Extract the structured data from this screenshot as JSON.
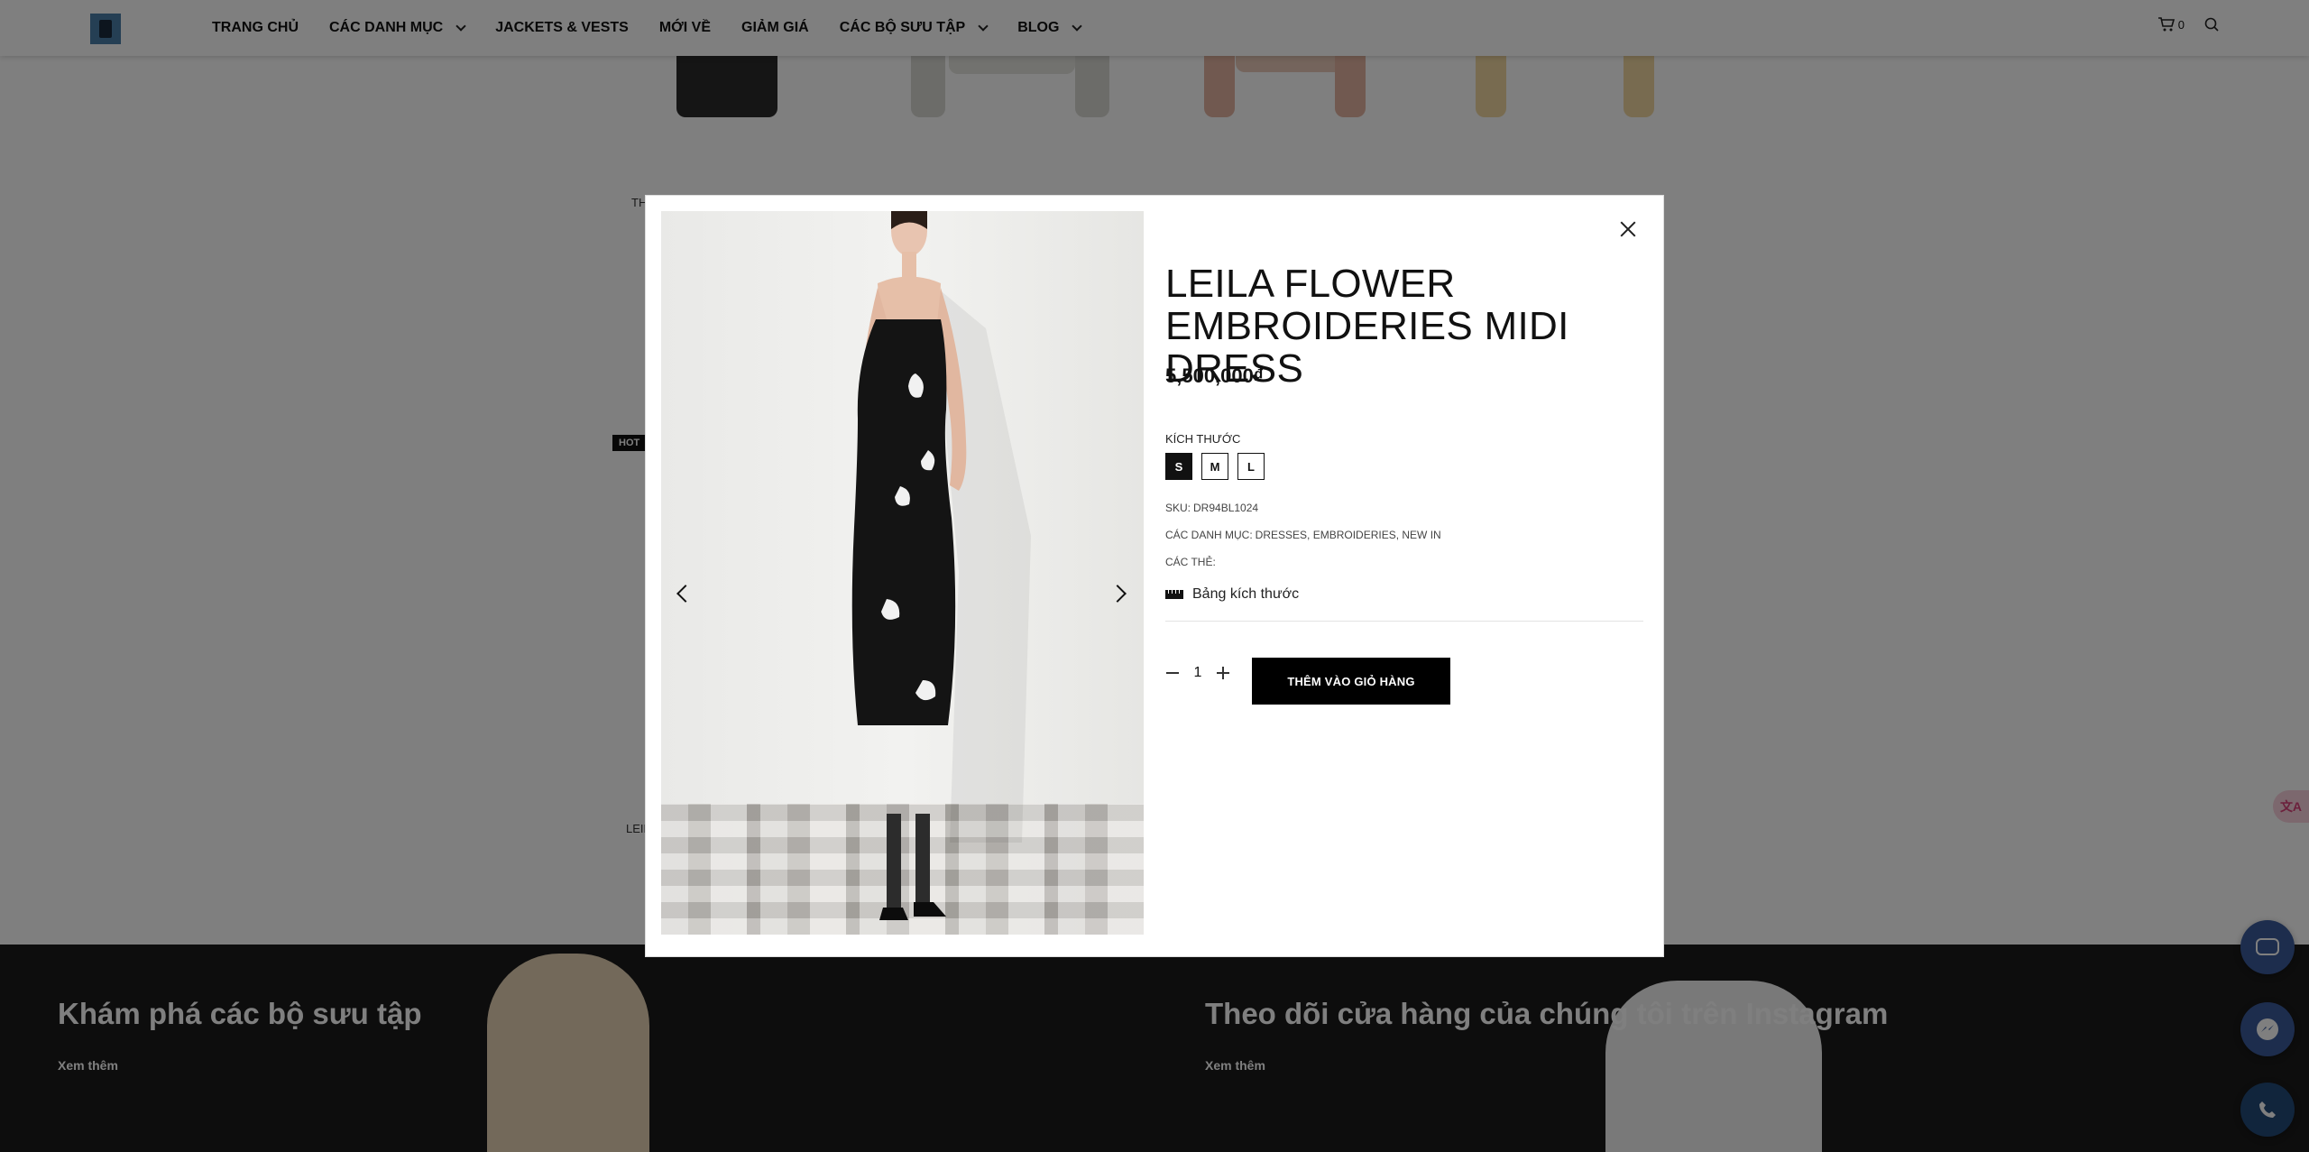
{
  "header": {
    "nav": [
      {
        "label": "TRANG CHỦ"
      },
      {
        "label": "CÁC DANH MỤC"
      },
      {
        "label": "JACKETS & VESTS"
      },
      {
        "label": "MỚI VỀ"
      },
      {
        "label": "GIẢM GIÁ"
      },
      {
        "label": "CÁC BỘ SƯU TẬP"
      },
      {
        "label": "BLOG"
      }
    ],
    "cart_count": "0"
  },
  "background": {
    "text_th": "TH",
    "text_leil": "LEIL",
    "hot_badge": "HOT"
  },
  "footer": {
    "left_title": "Khám phá các bộ sưu tập",
    "left_link": "Xem thêm",
    "right_title": "Theo dõi cửa hàng của chúng tôi trên Instagram",
    "right_link": "Xem thêm"
  },
  "float": {
    "translate_label": "文A"
  },
  "modal": {
    "title": "LEILA FLOWER EMBROIDERIES MIDI DRESS",
    "price": "5,500,000₫",
    "size_label": "KÍCH THƯỚC",
    "sizes": [
      "S",
      "M",
      "L"
    ],
    "selected_size": "S",
    "sku_label": "SKU:",
    "sku_value": "DR94BL1024",
    "categories_label": "CÁC DANH MỤC:",
    "categories_value": "DRESSES, EMBROIDERIES, NEW IN",
    "tags_label": "CÁC THẺ:",
    "size_guide": "Bảng kích thước",
    "quantity": "1",
    "add_to_cart": "THÊM VÀO GIỎ HÀNG"
  },
  "colors": {
    "accent": "#000000",
    "overlay": "rgba(0,0,0,0.5)",
    "footer_bg": "#1a1a1a",
    "float_btn": "#3b5a9a"
  }
}
